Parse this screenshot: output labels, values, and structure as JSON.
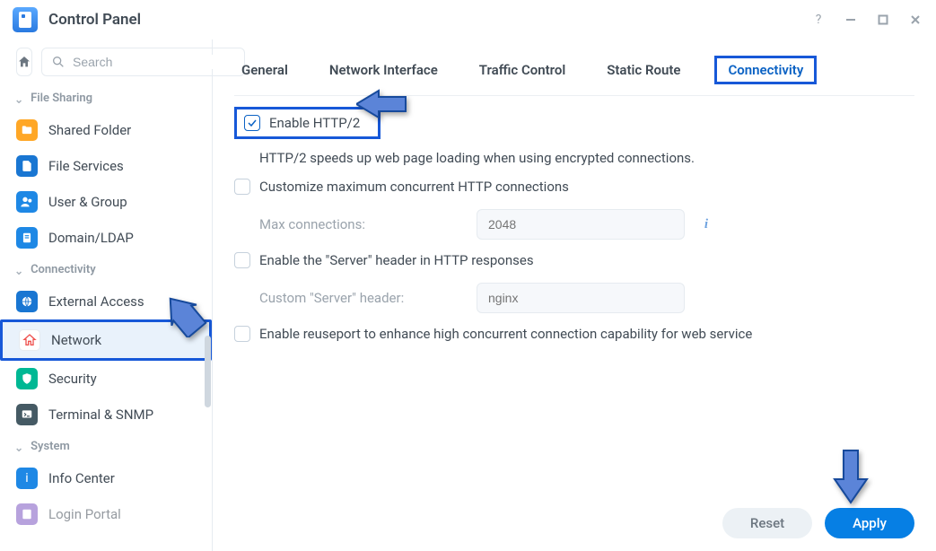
{
  "window": {
    "title": "Control Panel"
  },
  "sidebar": {
    "search_placeholder": "Search",
    "sections": {
      "file_sharing": {
        "title": "File Sharing",
        "items": [
          "Shared Folder",
          "File Services",
          "User & Group",
          "Domain/LDAP"
        ]
      },
      "connectivity": {
        "title": "Connectivity",
        "items": [
          "External Access",
          "Network",
          "Security",
          "Terminal & SNMP"
        ]
      },
      "system": {
        "title": "System",
        "items": [
          "Info Center",
          "Login Portal"
        ]
      }
    }
  },
  "tabs": [
    "General",
    "Network Interface",
    "Traffic Control",
    "Static Route",
    "Connectivity"
  ],
  "form": {
    "enable_http2": {
      "label": "Enable HTTP/2",
      "checked": true,
      "desc": "HTTP/2 speeds up web page loading when using encrypted connections."
    },
    "customize_conn": {
      "label": "Customize maximum concurrent HTTP connections",
      "checked": false,
      "max_label": "Max connections:",
      "max_placeholder": "2048"
    },
    "server_header": {
      "label": "Enable the \"Server\" header in HTTP responses",
      "checked": false,
      "custom_label": "Custom \"Server\" header:",
      "custom_placeholder": "nginx"
    },
    "reuseport": {
      "label": "Enable reuseport to enhance high concurrent connection capability for web service",
      "checked": false
    }
  },
  "buttons": {
    "reset": "Reset",
    "apply": "Apply"
  }
}
